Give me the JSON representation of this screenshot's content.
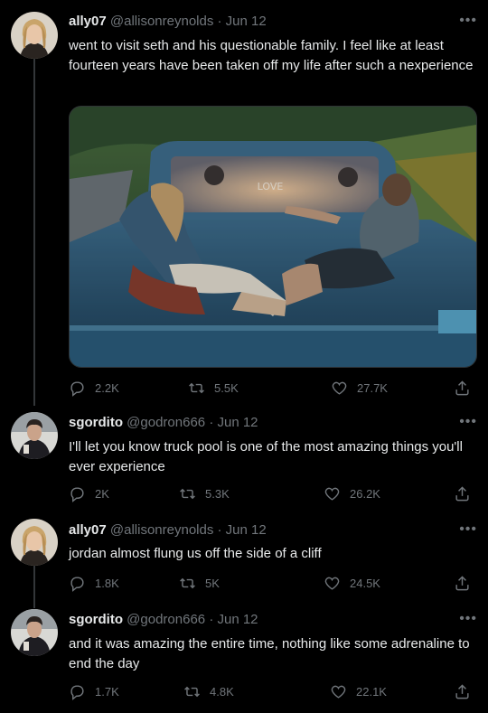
{
  "tweets": [
    {
      "name": "ally07",
      "handle": "@allisonreynolds",
      "date": "· Jun 12",
      "text": "went to visit seth and his questionable family. I feel like at least fourteen years have been taken off my life after such a nexperience",
      "replies": "2.2K",
      "retweets": "5.5K",
      "likes": "27.7K"
    },
    {
      "name": "sgordito",
      "handle": "@godron666",
      "date": "· Jun 12",
      "text": "I'll let you know truck pool is one of the most amazing things you'll ever experience",
      "replies": "2K",
      "retweets": "5.3K",
      "likes": "26.2K"
    },
    {
      "name": "ally07",
      "handle": "@allisonreynolds",
      "date": "· Jun 12",
      "text": "jordan almost flung us off the side of a cliff",
      "replies": "1.8K",
      "retweets": "5K",
      "likes": "24.5K"
    },
    {
      "name": "sgordito",
      "handle": "@godron666",
      "date": "· Jun 12",
      "text": "and it was amazing the entire time, nothing like some adrenaline to end the day",
      "replies": "1.7K",
      "retweets": "4.8K",
      "likes": "22.1K"
    }
  ],
  "media": {
    "window_text": "LOVE"
  },
  "icons": {
    "reply": "reply-icon",
    "retweet": "retweet-icon",
    "like": "heart-icon",
    "share": "share-icon",
    "more": "more-icon"
  },
  "colors": {
    "background": "#000000",
    "text": "#e7e9ea",
    "muted": "#71767b",
    "thread": "#333639"
  }
}
